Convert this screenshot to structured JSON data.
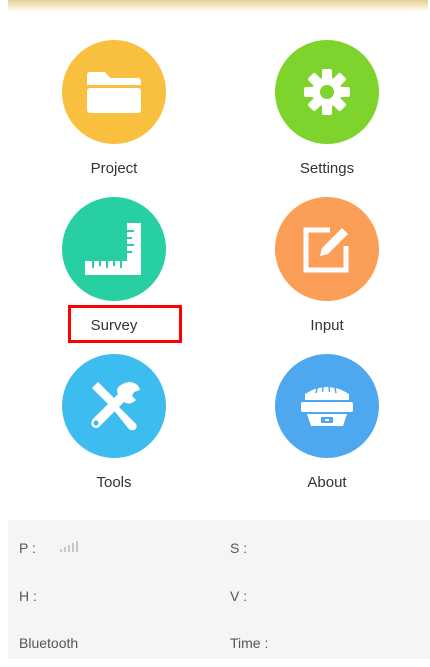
{
  "menu": {
    "project": {
      "label": "Project",
      "icon": "folder-icon",
      "color": "#f8c03e"
    },
    "settings": {
      "label": "Settings",
      "icon": "gear-icon",
      "color": "#7ed32c"
    },
    "survey": {
      "label": "Survey",
      "icon": "ruler-icon",
      "color": "#27cfa2"
    },
    "input": {
      "label": "Input",
      "icon": "edit-icon",
      "color": "#fb9f58"
    },
    "tools": {
      "label": "Tools",
      "icon": "wrench-screwdriver-icon",
      "color": "#3dbcef"
    },
    "about": {
      "label": "About",
      "icon": "gnss-receiver-icon",
      "color": "#4ea8f0"
    }
  },
  "highlight_color": "#ff0000",
  "status": {
    "p_label": "P :",
    "s_label": "S :",
    "h_label": "H :",
    "v_label": "V :",
    "bluetooth_label": "Bluetooth",
    "time_label": "Time :"
  }
}
